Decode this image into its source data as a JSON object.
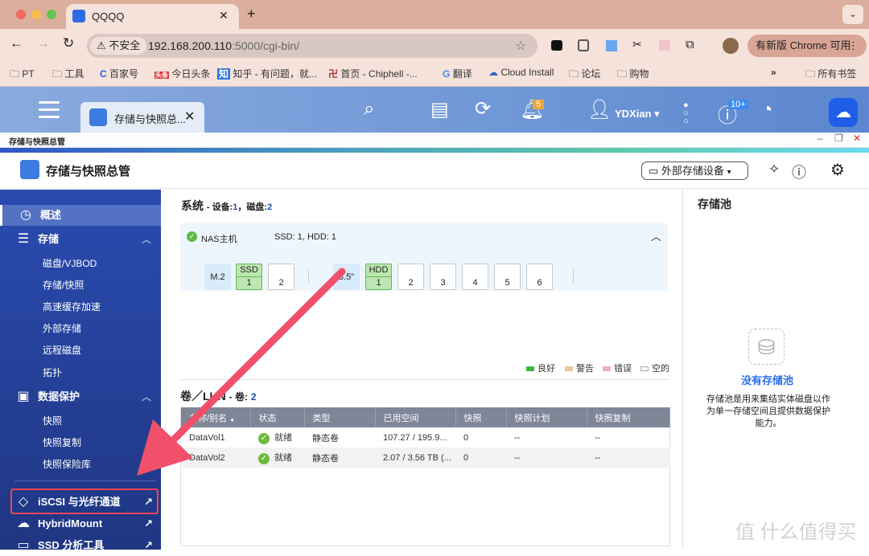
{
  "browser": {
    "tab_title": "QQQQ",
    "new_tab": "+",
    "security": "不安全",
    "url_host": "192.168.200.110",
    "url_rest": ":5000/cgi-bin/",
    "update_label": "有新版 Chrome 可用",
    "bookmarks": [
      "PT",
      "工具",
      "百家号",
      "今日头条",
      "知乎 - 有问题，就...",
      "首页 - Chiphell -...",
      "翻译",
      "Cloud Install",
      "论坛",
      "购物"
    ],
    "more": "»",
    "all_bookmarks": "所有书签"
  },
  "qts": {
    "app_tab": "存储与快照总...",
    "user": "YDXian",
    "notif_badge": "5",
    "info_badge": "10+",
    "window_title": "存储与快照总管"
  },
  "app": {
    "title": "存储与快照总管",
    "external_button": "外部存储设备"
  },
  "sidebar": {
    "overview": "概述",
    "storage": "存储",
    "storage_items": [
      "磁盘/VJBOD",
      "存储/快照",
      "高速缓存加速",
      "外部存储",
      "远程磁盘",
      "拓扑"
    ],
    "protection": "数据保护",
    "protection_items": [
      "快照",
      "快照复制",
      "快照保险库"
    ],
    "iscsi": "iSCSI 与光纤通道",
    "hybrid": "HybridMount",
    "ssd": "SSD 分析工具"
  },
  "system": {
    "title": "系统",
    "sub_prefix": "- 设备:",
    "devices": "1",
    "disk_label": "，磁盘:",
    "disks": "2",
    "host": "NAS主机",
    "summary": "SSD: 1, HDD: 1",
    "m2": "M.2",
    "m2_slots": [
      {
        "type": "SSD",
        "n": "1"
      },
      {
        "type": "",
        "n": "2"
      }
    ],
    "bay": "3.5\"",
    "bay_slots": [
      {
        "type": "HDD",
        "n": "1"
      },
      {
        "type": "",
        "n": "2"
      },
      {
        "type": "",
        "n": "3"
      },
      {
        "type": "",
        "n": "4"
      },
      {
        "type": "",
        "n": "5"
      },
      {
        "type": "",
        "n": "6"
      }
    ]
  },
  "legend": {
    "good": "良好",
    "warn": "警告",
    "error": "错误",
    "empty": "空的",
    "colors": {
      "good": "#3db83d",
      "warn": "#e8c89a",
      "error": "#eab0b4"
    }
  },
  "volumes": {
    "title": "卷／LUN",
    "sub": "- 卷:",
    "count": "2",
    "columns": [
      "名称/别名",
      "状态",
      "类型",
      "已用空间",
      "快照",
      "快照计划",
      "快照复制"
    ],
    "rows": [
      [
        "DataVol1",
        "就绪",
        "静态卷",
        "107.27 / 195.9...",
        "0",
        "--",
        "--"
      ],
      [
        "DataVol2",
        "就绪",
        "静态卷",
        "2.07 / 3.56 TB (...",
        "0",
        "--",
        "--"
      ]
    ]
  },
  "pool": {
    "title": "存储池",
    "empty_title": "没有存储池",
    "desc": "存储池是用来集结实体磁盘以作为单一存储空间且提供数据保护能力。"
  },
  "watermark": "值 什么值得买"
}
